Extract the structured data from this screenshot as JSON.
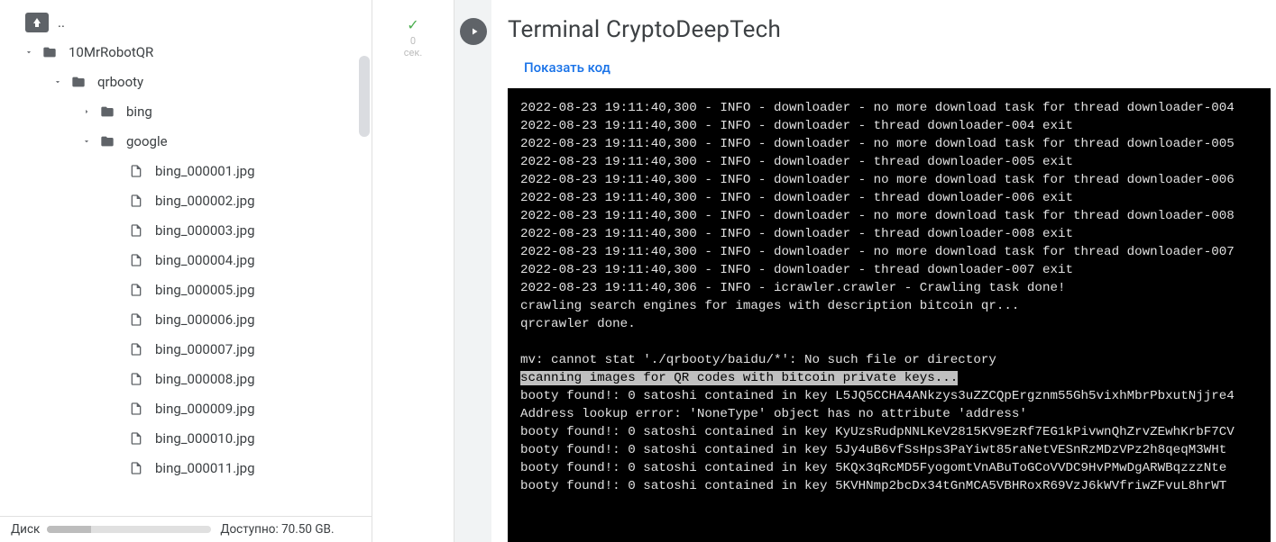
{
  "sidebar": {
    "up_label": "..",
    "tree": [
      {
        "label": "10MrRobotQR",
        "type": "folder",
        "indent": 1,
        "expanded": true
      },
      {
        "label": "qrbooty",
        "type": "folder",
        "indent": 2,
        "expanded": true
      },
      {
        "label": "bing",
        "type": "folder",
        "indent": 3,
        "expanded": false
      },
      {
        "label": "google",
        "type": "folder",
        "indent": 3,
        "expanded": true
      },
      {
        "label": "bing_000001.jpg",
        "type": "file",
        "indent": 4
      },
      {
        "label": "bing_000002.jpg",
        "type": "file",
        "indent": 4
      },
      {
        "label": "bing_000003.jpg",
        "type": "file",
        "indent": 4
      },
      {
        "label": "bing_000004.jpg",
        "type": "file",
        "indent": 4
      },
      {
        "label": "bing_000005.jpg",
        "type": "file",
        "indent": 4
      },
      {
        "label": "bing_000006.jpg",
        "type": "file",
        "indent": 4
      },
      {
        "label": "bing_000007.jpg",
        "type": "file",
        "indent": 4
      },
      {
        "label": "bing_000008.jpg",
        "type": "file",
        "indent": 4
      },
      {
        "label": "bing_000009.jpg",
        "type": "file",
        "indent": 4
      },
      {
        "label": "bing_000010.jpg",
        "type": "file",
        "indent": 4
      },
      {
        "label": "bing_000011.jpg",
        "type": "file",
        "indent": 4
      }
    ],
    "disk_label": "Диск",
    "disk_available": "Доступно: 70.50 GB."
  },
  "gutter": {
    "seconds_value": "0",
    "seconds_unit": "сек."
  },
  "content": {
    "title": "Terminal CryptoDeepTech",
    "show_code": "Показать код"
  },
  "terminal": {
    "lines": [
      "2022-08-23 19:11:40,300 - INFO - downloader - no more download task for thread downloader-004",
      "2022-08-23 19:11:40,300 - INFO - downloader - thread downloader-004 exit",
      "2022-08-23 19:11:40,300 - INFO - downloader - no more download task for thread downloader-005",
      "2022-08-23 19:11:40,300 - INFO - downloader - thread downloader-005 exit",
      "2022-08-23 19:11:40,300 - INFO - downloader - no more download task for thread downloader-006",
      "2022-08-23 19:11:40,300 - INFO - downloader - thread downloader-006 exit",
      "2022-08-23 19:11:40,300 - INFO - downloader - no more download task for thread downloader-008",
      "2022-08-23 19:11:40,300 - INFO - downloader - thread downloader-008 exit",
      "2022-08-23 19:11:40,300 - INFO - downloader - no more download task for thread downloader-007",
      "2022-08-23 19:11:40,300 - INFO - downloader - thread downloader-007 exit",
      "2022-08-23 19:11:40,306 - INFO - icrawler.crawler - Crawling task done!",
      "crawling search engines for images with description bitcoin qr...",
      "qrcrawler done.",
      "",
      "mv: cannot stat './qrbooty/baidu/*': No such file or directory",
      "scanning images for QR codes with bitcoin private keys...",
      "booty found!: 0 satoshi contained in key L5JQ5CCHA4ANkzys3uZZCQpErgznm55Gh5vixhMbrPbxutNjjre4",
      "Address lookup error: 'NoneType' object has no attribute 'address'",
      "booty found!: 0 satoshi contained in key KyUzsRudpNNLKeV2815KV9EzRf7EG1kPivwnQhZrvZEwhKrbF7CV",
      "booty found!: 0 satoshi contained in key 5Jy4uB6vfSsHps3PaYiwt85raNetVESnRzMDzVPz2h8qeqM3WHt",
      "booty found!: 0 satoshi contained in key 5KQx3qRcMD5FyogomtVnABuToGCoVVDC9HvPMwDgARWBqzzzNte",
      "booty found!: 0 satoshi contained in key 5KVHNmp2bcDx34tGnMCA5VBHRoxR69VzJ6kWVfriwZFvuL8hrWT"
    ],
    "highlight_index": 15
  }
}
